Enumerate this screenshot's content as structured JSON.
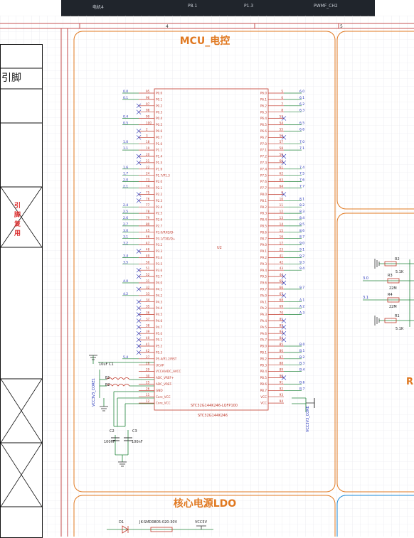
{
  "topbar": {
    "cells": [
      "电机4",
      "P8.1",
      "P1.3",
      "PWMF_CH2"
    ]
  },
  "ruler": {
    "col4": "4",
    "col5": "5"
  },
  "left_panel": {
    "header": "引脚",
    "vertical_note": [
      "引",
      "脚",
      "复",
      "用"
    ]
  },
  "mcu": {
    "title": "MCU_电控",
    "designator": "U2",
    "part_label": "STC32G144K246-LQFP100",
    "part_label2": "STC32G144K246",
    "left_pins": [
      {
        "net": "0.0",
        "num": "95",
        "name": "P0.0"
      },
      {
        "net": "0.1",
        "num": "96",
        "name": "P0.1"
      },
      {
        "net": "",
        "num": "97",
        "name": "P0.2"
      },
      {
        "net": "",
        "num": "98",
        "name": "P0.3"
      },
      {
        "net": "0.4",
        "num": "99",
        "name": "P0.4"
      },
      {
        "net": "0.5",
        "num": "100",
        "name": "P0.5"
      },
      {
        "net": "",
        "num": "2",
        "name": "P0.6"
      },
      {
        "net": "",
        "num": "3",
        "name": "P0.7"
      },
      {
        "net": "1.0",
        "num": "18",
        "name": "P1.0"
      },
      {
        "net": "1.1",
        "num": "19",
        "name": "P1.1"
      },
      {
        "net": "",
        "num": "20",
        "name": "P1.4"
      },
      {
        "net": "",
        "num": "21",
        "name": "P1.5"
      },
      {
        "net": "1.6",
        "num": "22",
        "name": "P1.6"
      },
      {
        "net": "1.7",
        "num": "24",
        "name": "P1.7/P1.3"
      },
      {
        "net": "2.0",
        "num": "73",
        "name": "P2.0"
      },
      {
        "net": "2.1",
        "num": "74",
        "name": "P2.1"
      },
      {
        "net": "",
        "num": "75",
        "name": "P2.2"
      },
      {
        "net": "",
        "num": "76",
        "name": "P2.3"
      },
      {
        "net": "2.4",
        "num": "77",
        "name": "P2.4"
      },
      {
        "net": "2.5",
        "num": "78",
        "name": "P2.5"
      },
      {
        "net": "2.6",
        "num": "79",
        "name": "P2.6"
      },
      {
        "net": "2.7",
        "num": "80",
        "name": "P2.7"
      },
      {
        "net": "3.0",
        "num": "45",
        "name": "P3.0/RXD/D-"
      },
      {
        "net": "3.1",
        "num": "46",
        "name": "P3.1/TXD/D+"
      },
      {
        "net": "3.2",
        "num": "47",
        "name": "P3.2"
      },
      {
        "net": "",
        "num": "48",
        "name": "P3.3"
      },
      {
        "net": "3.4",
        "num": "49",
        "name": "P3.4"
      },
      {
        "net": "3.5",
        "num": "50",
        "name": "P3.5"
      },
      {
        "net": "",
        "num": "51",
        "name": "P3.6"
      },
      {
        "net": "",
        "num": "52",
        "name": "P3.7"
      },
      {
        "net": "4.0",
        "num": "31",
        "name": "P4.0"
      },
      {
        "net": "",
        "num": "32",
        "name": "P4.1"
      },
      {
        "net": "4.2",
        "num": "33",
        "name": "P4.2"
      },
      {
        "net": "",
        "num": "34",
        "name": "P4.3"
      },
      {
        "net": "",
        "num": "35",
        "name": "P4.4"
      },
      {
        "net": "",
        "num": "36",
        "name": "P4.5"
      },
      {
        "net": "",
        "num": "37",
        "name": "P4.6"
      },
      {
        "net": "",
        "num": "38",
        "name": "P4.7"
      },
      {
        "net": "",
        "num": "39",
        "name": "P5.0"
      },
      {
        "net": "",
        "num": "40",
        "name": "P5.1"
      },
      {
        "net": "",
        "num": "41",
        "name": "P5.2"
      },
      {
        "net": "",
        "num": "42",
        "name": "P5.3"
      },
      {
        "net": "5.4",
        "num": "27",
        "name": "P5.4/P1.2/RST"
      },
      {
        "net": "",
        "num": "28",
        "name": "UCAP"
      },
      {
        "net": "",
        "num": "29",
        "name": "VCCA/ADC_AVCC"
      },
      {
        "net": "",
        "num": "30",
        "name": "ADC_VREF+"
      },
      {
        "net": "",
        "num": "25",
        "name": "ADC_VREF-"
      },
      {
        "net": "",
        "num": "26",
        "name": "GND"
      },
      {
        "net": "",
        "num": "11",
        "name": "Core_VCC"
      },
      {
        "net": "",
        "num": "12",
        "name": "Core_VCC"
      }
    ],
    "right_pins": [
      {
        "net": "6.0",
        "num": "5",
        "name": "P6.0"
      },
      {
        "net": "6.1",
        "num": "6",
        "name": "P6.1"
      },
      {
        "net": "6.2",
        "num": "7",
        "name": "P6.2"
      },
      {
        "net": "6.3",
        "num": "8",
        "name": "P6.3"
      },
      {
        "net": "",
        "num": "53",
        "name": "P6.4"
      },
      {
        "net": "6.5",
        "num": "54",
        "name": "P6.5"
      },
      {
        "net": "6.6",
        "num": "55",
        "name": "P6.6"
      },
      {
        "net": "",
        "num": "56",
        "name": "P6.7"
      },
      {
        "net": "7.0",
        "num": "57",
        "name": "P7.0"
      },
      {
        "net": "7.1",
        "num": "58",
        "name": "P7.1"
      },
      {
        "net": "",
        "num": "59",
        "name": "P7.2"
      },
      {
        "net": "",
        "num": "60",
        "name": "P7.3"
      },
      {
        "net": "7.4",
        "num": "61",
        "name": "P7.4"
      },
      {
        "net": "7.5",
        "num": "62",
        "name": "P7.5"
      },
      {
        "net": "7.6",
        "num": "63",
        "name": "P7.6"
      },
      {
        "net": "7.7",
        "num": "64",
        "name": "P7.7"
      },
      {
        "net": "",
        "num": "9",
        "name": "P8.0"
      },
      {
        "net": "8.1",
        "num": "10",
        "name": "P8.1"
      },
      {
        "net": "8.2",
        "num": "11",
        "name": "P8.2"
      },
      {
        "net": "8.3",
        "num": "12",
        "name": "P8.3"
      },
      {
        "net": "8.4",
        "num": "13",
        "name": "P8.4"
      },
      {
        "net": "8.5",
        "num": "14",
        "name": "P8.5"
      },
      {
        "net": "8.6",
        "num": "15",
        "name": "P8.6"
      },
      {
        "net": "8.7",
        "num": "16",
        "name": "P8.7"
      },
      {
        "net": "9.0",
        "num": "17",
        "name": "P9.0"
      },
      {
        "net": "9.1",
        "num": "23",
        "name": "P9.1"
      },
      {
        "net": "9.2",
        "num": "41",
        "name": "P9.2"
      },
      {
        "net": "9.3",
        "num": "42",
        "name": "P9.3"
      },
      {
        "net": "9.4",
        "num": "43",
        "name": "P9.4"
      },
      {
        "net": "",
        "num": "44",
        "name": "P9.5"
      },
      {
        "net": "",
        "num": "65",
        "name": "P9.6"
      },
      {
        "net": "9.7",
        "num": "66",
        "name": "P9.7"
      },
      {
        "net": "",
        "num": "67",
        "name": "PA.0"
      },
      {
        "net": "A.1",
        "num": "68",
        "name": "PA.1"
      },
      {
        "net": "A.2",
        "num": "69",
        "name": "PA.2"
      },
      {
        "net": "A.3",
        "num": "70",
        "name": "PA.3"
      },
      {
        "net": "",
        "num": "81",
        "name": "PA.4"
      },
      {
        "net": "",
        "num": "82",
        "name": "PA.5"
      },
      {
        "net": "",
        "num": "83",
        "name": "PA.6"
      },
      {
        "net": "",
        "num": "84",
        "name": "PA.7"
      },
      {
        "net": "B.0",
        "num": "85",
        "name": "PB.0"
      },
      {
        "net": "B.1",
        "num": "86",
        "name": "PB.1"
      },
      {
        "net": "B.2",
        "num": "87",
        "name": "PB.2"
      },
      {
        "net": "B.3",
        "num": "88",
        "name": "PB.3"
      },
      {
        "net": "B.4",
        "num": "89",
        "name": "PB.4"
      },
      {
        "net": "",
        "num": "90",
        "name": "PB.5"
      },
      {
        "net": "B.6",
        "num": "91",
        "name": "PB.6"
      },
      {
        "net": "B.7",
        "num": "92",
        "name": "PB.7"
      },
      {
        "net": "",
        "num": "93",
        "name": "VCC"
      },
      {
        "net": "",
        "num": "94",
        "name": "VCC"
      }
    ],
    "c1_label": "10uF C1",
    "l_labels": [
      "B1",
      "B2"
    ],
    "vcc_left": "VCC3V3_CORE1",
    "vcc_right": "VCC3V3_CORE",
    "caps": [
      {
        "ref": "C2",
        "val": "100nF"
      },
      {
        "ref": "C3",
        "val": "100nF"
      }
    ]
  },
  "right_block": {
    "resistors": [
      {
        "ref": "R2",
        "val": "5.1K"
      },
      {
        "ref": "R3",
        "val": "22M"
      },
      {
        "ref": "R4",
        "val": "22M"
      },
      {
        "ref": "R1",
        "val": "5.1K"
      }
    ],
    "nets": [
      "3.0",
      "3.1"
    ],
    "edge_letter": "R"
  },
  "ldo": {
    "title": "核心电源LDO",
    "d1": "D1",
    "part": "JK-SMD0805-020-30V",
    "vcc": "VCC5V"
  },
  "colors": {
    "orange": "#e07820",
    "pin_red": "#c0392b",
    "net_blue": "#1f2fb8",
    "wire_green": "#20843a",
    "frame": "#b41e1e",
    "grid": "#e4e4ea"
  }
}
